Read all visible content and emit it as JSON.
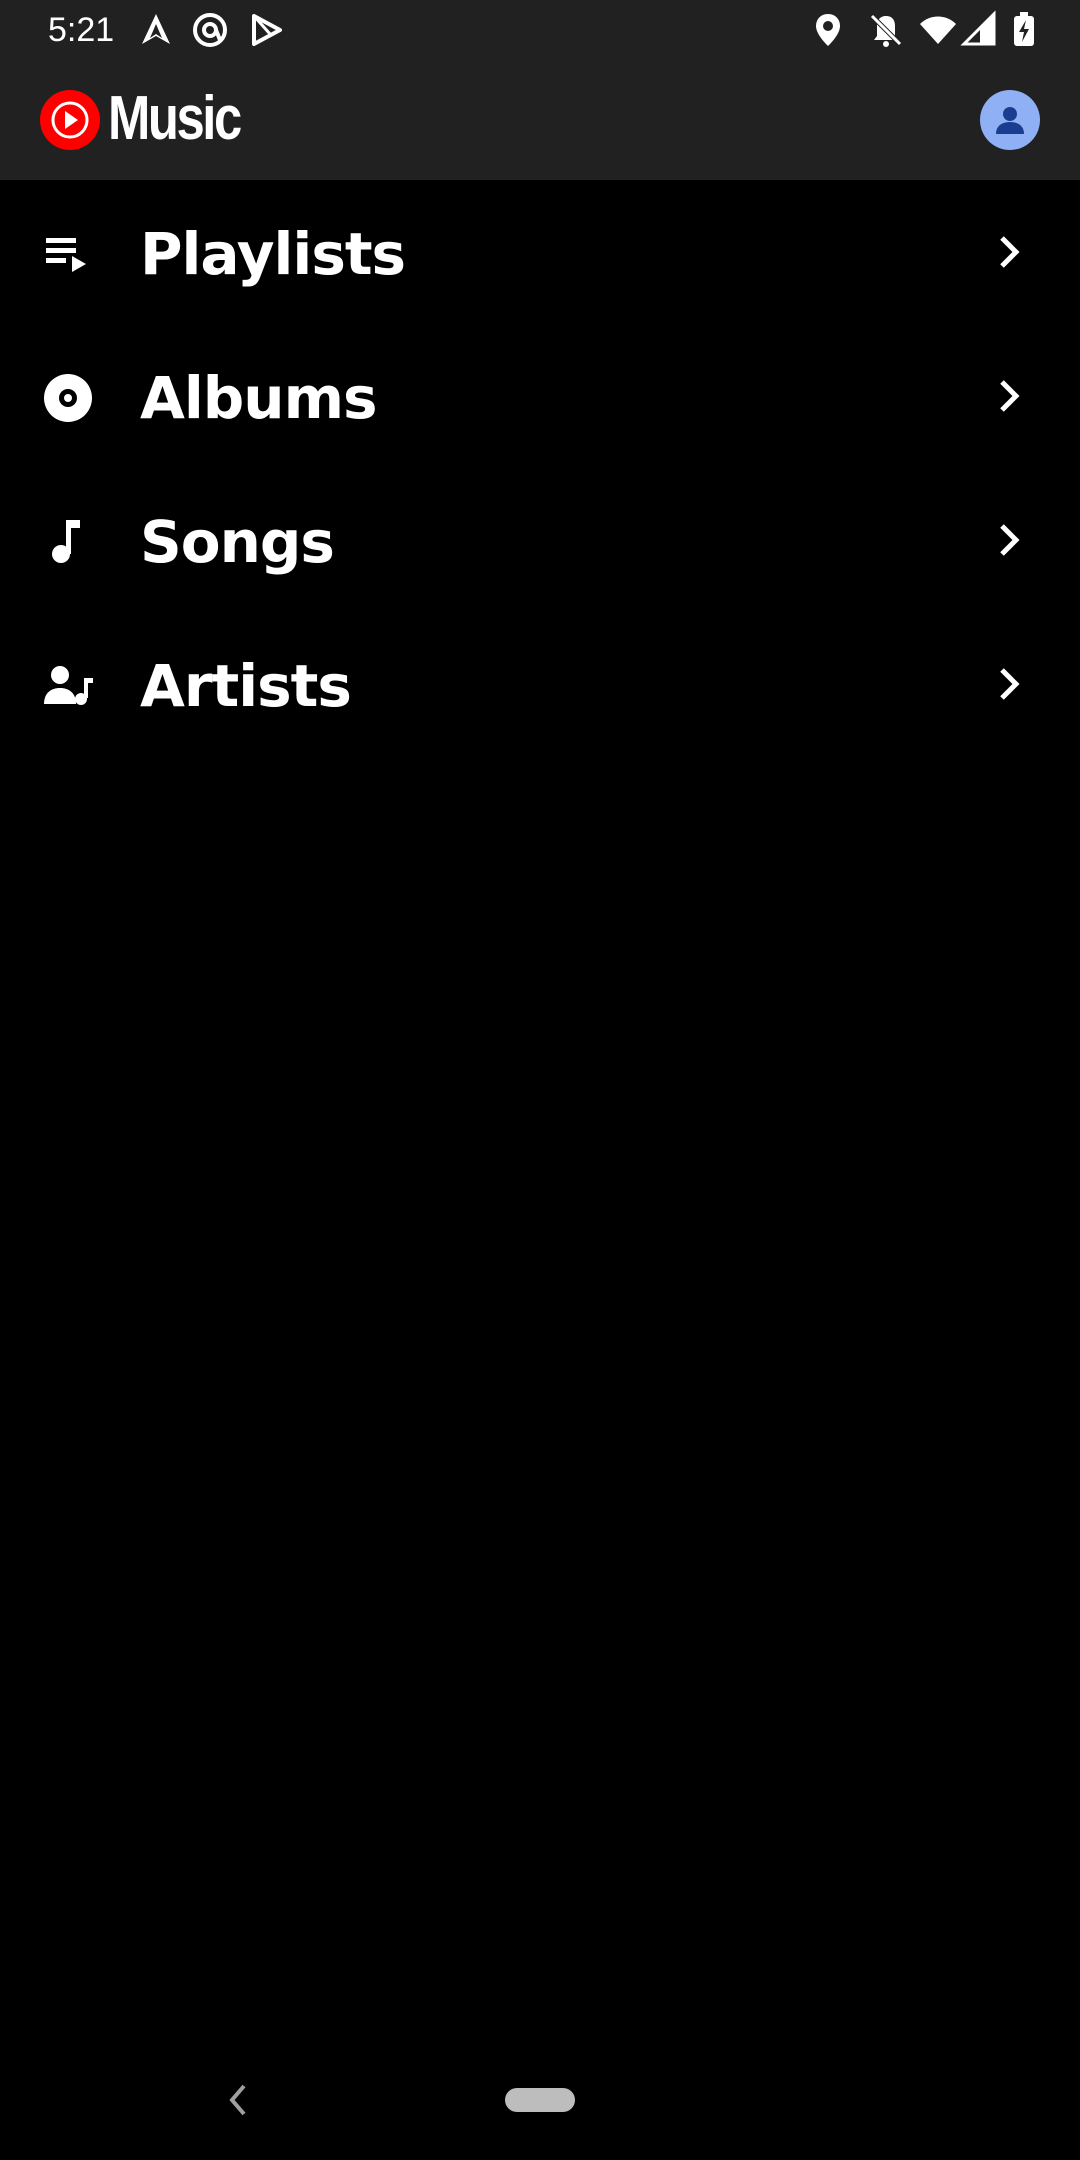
{
  "status_bar": {
    "time": "5:21",
    "left_icons": [
      "arrow-app-icon",
      "at-sign-app-icon",
      "play-store-icon"
    ],
    "right_icons": [
      "location-icon",
      "notifications-off-icon",
      "wifi-icon",
      "cellular-icon",
      "battery-charging-icon"
    ]
  },
  "app_bar": {
    "title": "Music",
    "logo_icon": "youtube-music-logo-icon",
    "avatar_icon": "account-icon",
    "brand_color": "#ff0000",
    "avatar_color": "#8fb0f5"
  },
  "library": {
    "items": [
      {
        "label": "Playlists",
        "icon": "playlist-icon"
      },
      {
        "label": "Albums",
        "icon": "album-icon"
      },
      {
        "label": "Songs",
        "icon": "music-note-icon"
      },
      {
        "label": "Artists",
        "icon": "artist-icon"
      }
    ]
  },
  "nav_bar": {
    "back_icon": "back-chevron-icon",
    "home_icon": "home-pill-icon"
  }
}
